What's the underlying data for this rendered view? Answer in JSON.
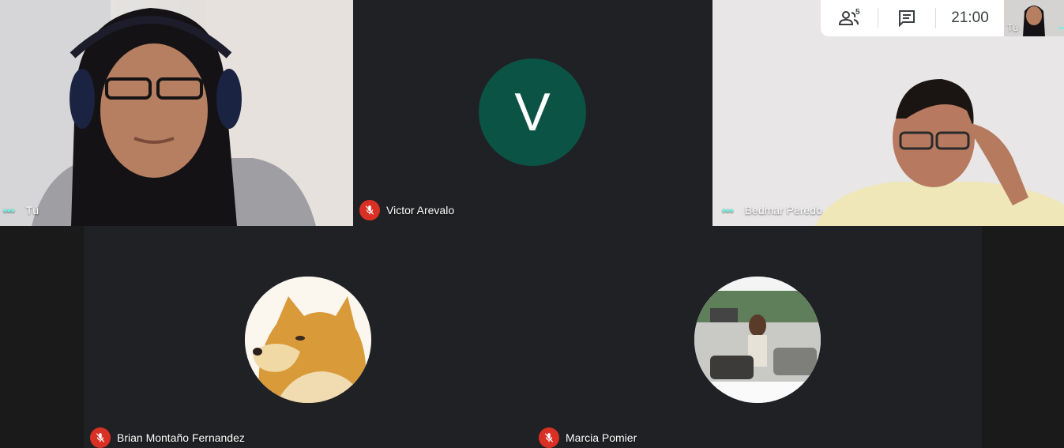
{
  "meeting": {
    "participant_count": "5",
    "clock": "21:00",
    "self_mini_label": "Tú"
  },
  "tiles": {
    "self": {
      "name": "Tú"
    },
    "victor": {
      "name": "Victor Arevalo",
      "initial": "V",
      "avatar_color": "#0b5345"
    },
    "bedmar": {
      "name": "Bedmar Peredo"
    },
    "brian": {
      "name": "Brian Montaño Fernandez"
    },
    "marcia": {
      "name": "Marcia Pomier"
    }
  },
  "icons": {
    "people": "people-icon",
    "chat": "chat-icon",
    "mic_off": "mic-off-icon",
    "more": "more-options-icon"
  },
  "colors": {
    "background": "#202124",
    "mic_off": "#d93025",
    "speaking_dots": "#6ff0dc"
  }
}
